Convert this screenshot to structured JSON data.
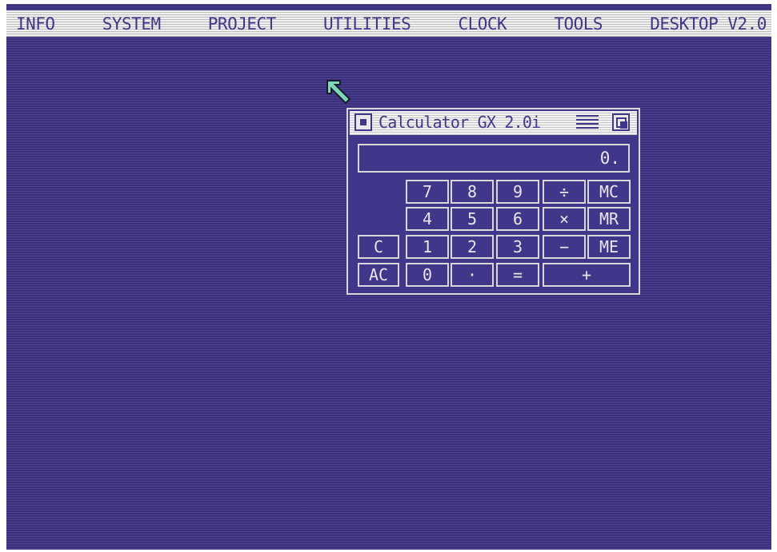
{
  "menubar": {
    "items": [
      "INFO",
      "SYSTEM",
      "PROJECT",
      "UTILITIES",
      "CLOCK",
      "TOOLS",
      "DESKTOP V2.0"
    ]
  },
  "calculator": {
    "title": "Calculator GX 2.0i",
    "display": "0.",
    "keys": {
      "k7": "7",
      "k8": "8",
      "k9": "9",
      "div": "÷",
      "mc": "MC",
      "k4": "4",
      "k5": "5",
      "k6": "6",
      "mul": "×",
      "mr": "MR",
      "c": "C",
      "k1": "1",
      "k2": "2",
      "k3": "3",
      "sub": "−",
      "me": "ME",
      "ac": "AC",
      "k0": "0",
      "dot": "·",
      "eq": "=",
      "add": "+"
    }
  },
  "colors": {
    "desktop": "#40368a",
    "menubar": "#d8d8d8",
    "foreground": "#e6e6e6",
    "cursor": "#7fd6b8"
  },
  "icons": {
    "cursor": "arrow-pointer-icon",
    "close": "close-box-icon",
    "title_stripes": "drag-stripes-icon",
    "resize": "resize-box-icon"
  }
}
